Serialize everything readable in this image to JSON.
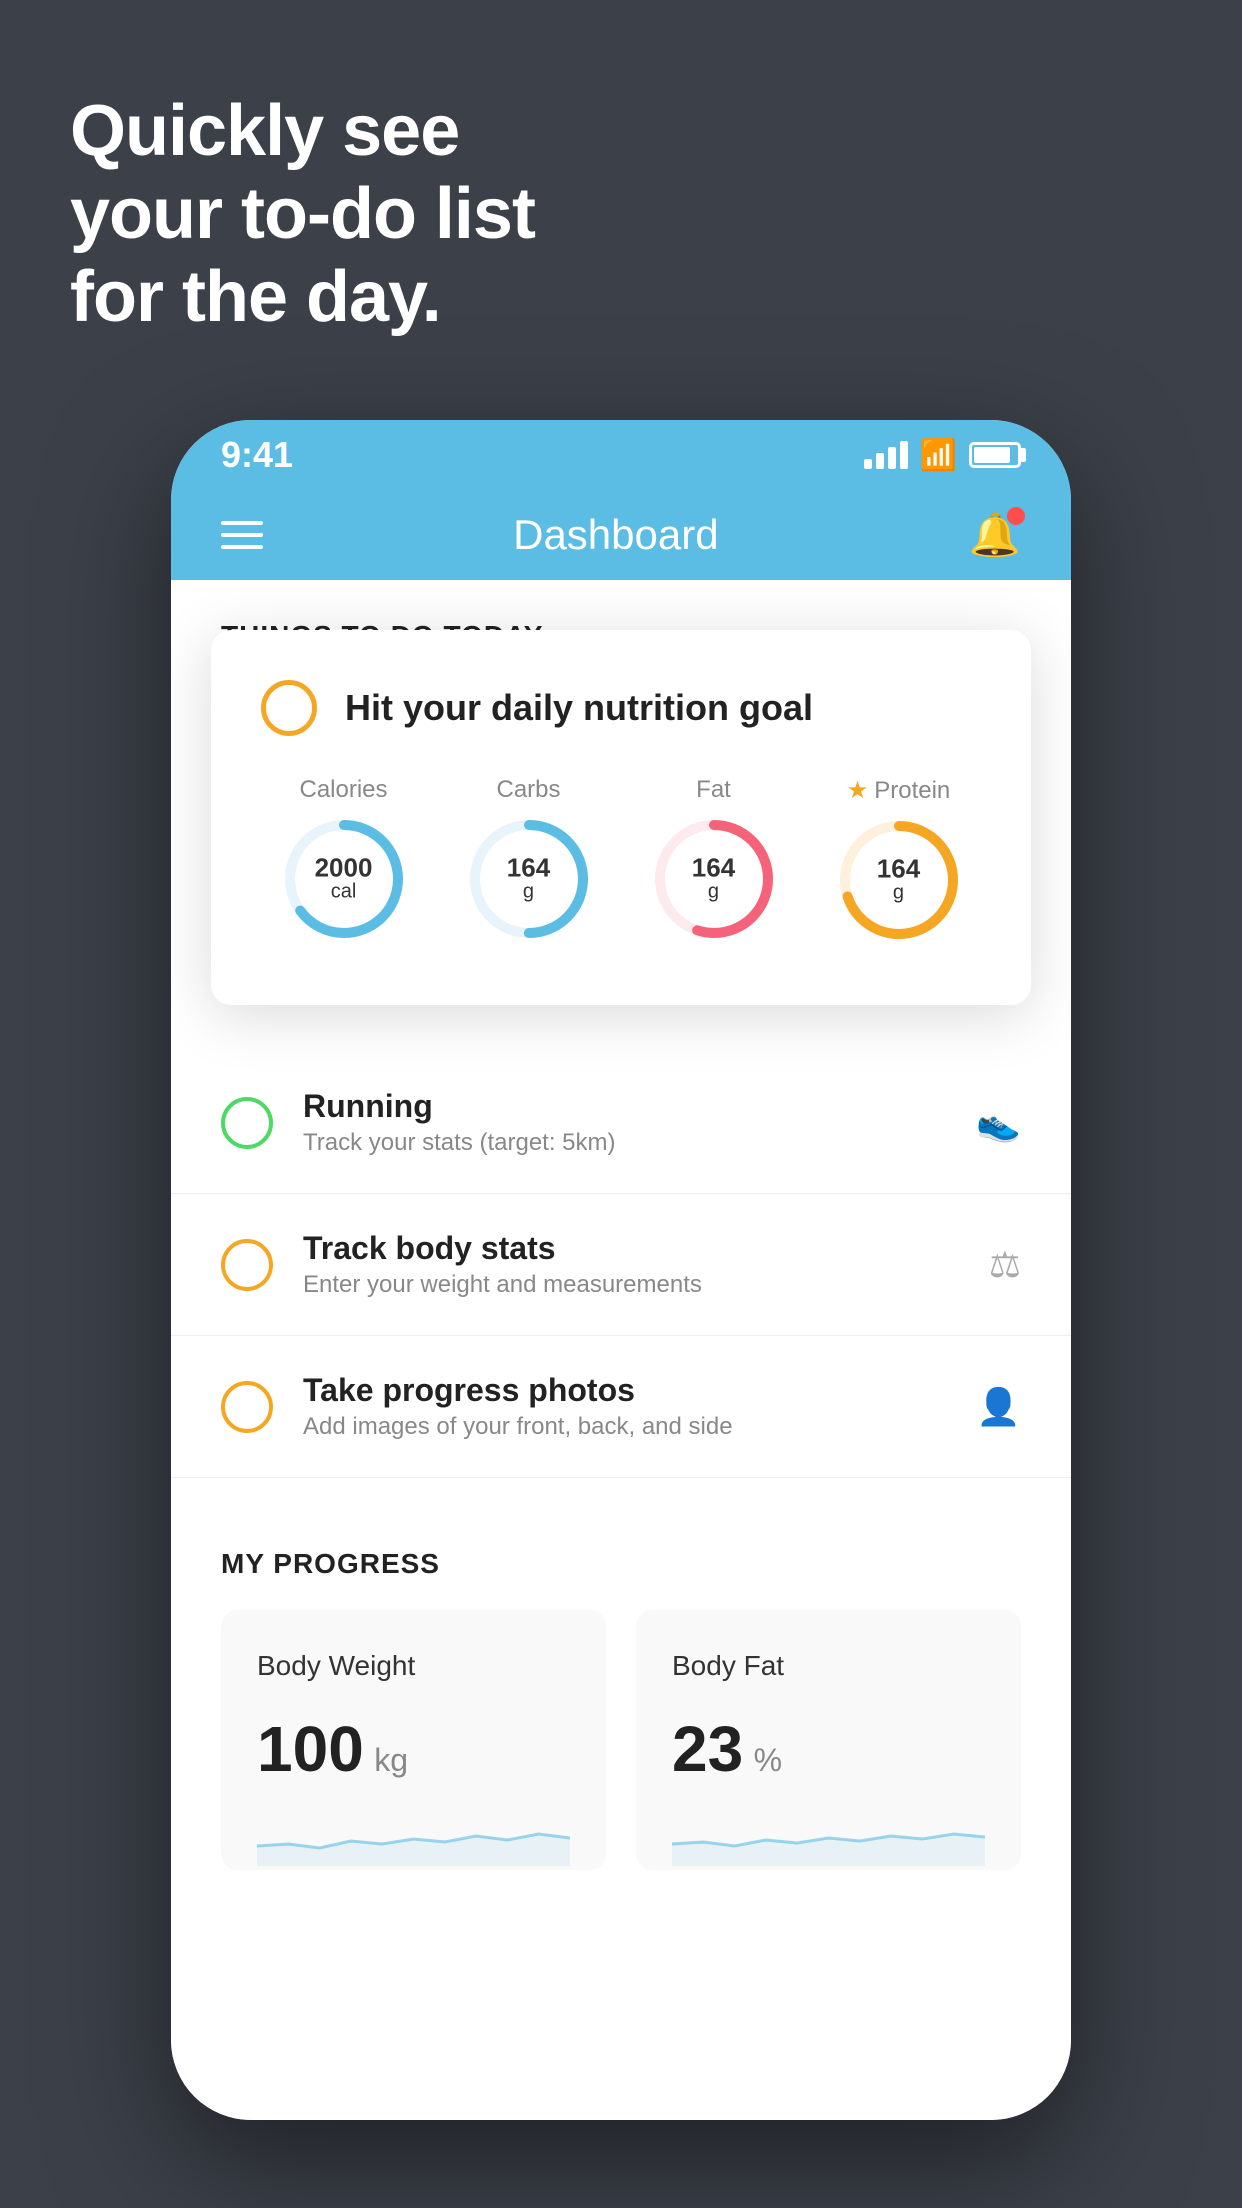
{
  "hero": {
    "line1": "Quickly see",
    "line2": "your to-do list",
    "line3": "for the day."
  },
  "phone": {
    "status_bar": {
      "time": "9:41"
    },
    "nav": {
      "title": "Dashboard"
    },
    "floating_card": {
      "title": "Hit your daily nutrition goal",
      "nutrition": [
        {
          "label": "Calories",
          "value": "2000",
          "unit": "cal",
          "color": "#5bbde4",
          "percent": 65,
          "starred": false
        },
        {
          "label": "Carbs",
          "value": "164",
          "unit": "g",
          "color": "#5bbde4",
          "percent": 50,
          "starred": false
        },
        {
          "label": "Fat",
          "value": "164",
          "unit": "g",
          "color": "#f5637a",
          "percent": 55,
          "starred": false
        },
        {
          "label": "Protein",
          "value": "164",
          "unit": "g",
          "color": "#f5a623",
          "percent": 70,
          "starred": true
        }
      ]
    },
    "things_section": "THINGS TO DO TODAY",
    "todo_items": [
      {
        "label": "Running",
        "sublabel": "Track your stats (target: 5km)",
        "circle_color": "green",
        "icon": "🏃"
      },
      {
        "label": "Track body stats",
        "sublabel": "Enter your weight and measurements",
        "circle_color": "yellow",
        "icon": "⚖"
      },
      {
        "label": "Take progress photos",
        "sublabel": "Add images of your front, back, and side",
        "circle_color": "yellow",
        "icon": "👤"
      }
    ],
    "progress_section": "MY PROGRESS",
    "progress_cards": [
      {
        "title": "Body Weight",
        "value": "100",
        "unit": "kg"
      },
      {
        "title": "Body Fat",
        "value": "23",
        "unit": "%"
      }
    ]
  }
}
